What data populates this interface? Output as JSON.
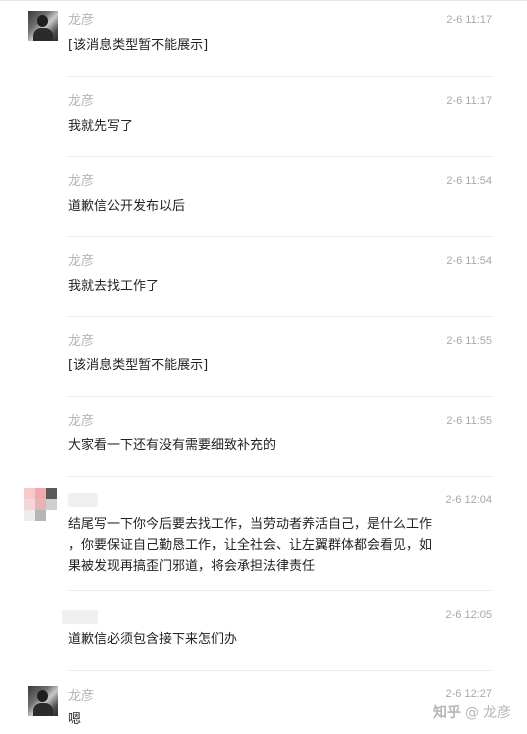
{
  "messages": [
    {
      "sender": "龙彦",
      "time": "2-6 11:17",
      "text": "[该消息类型暂不能展示]",
      "avatar": "photo"
    },
    {
      "sender": "龙彦",
      "time": "2-6 11:17",
      "text": "我就先写了"
    },
    {
      "sender": "龙彦",
      "time": "2-6 11:54",
      "text": "道歉信公开发布以后"
    },
    {
      "sender": "龙彦",
      "time": "2-6 11:54",
      "text": "我就去找工作了"
    },
    {
      "sender": "龙彦",
      "time": "2-6 11:55",
      "text": "[该消息类型暂不能展示]"
    },
    {
      "sender": "龙彦",
      "time": "2-6 11:55",
      "text": "大家看一下还有没有需要细致补充的"
    },
    {
      "sender": "",
      "time": "2-6 12:04",
      "text": "结尾写一下你今后要去找工作，当劳动者养活自己，是什么工作\n，你要保证自己勤恳工作，让全社会、让左翼群体都会看见，如\n果被发现再搞歪门邪道，将会承担法律责任",
      "avatar": "blurred"
    },
    {
      "sender": "",
      "time": "2-6 12:05",
      "text": "道歉信必须包含接下来怎们办"
    },
    {
      "sender": "龙彦",
      "time": "2-6 12:27",
      "text": "嗯",
      "avatar": "photo"
    }
  ],
  "watermark": {
    "brand": "知乎",
    "at": "@",
    "author": "龙彦"
  }
}
